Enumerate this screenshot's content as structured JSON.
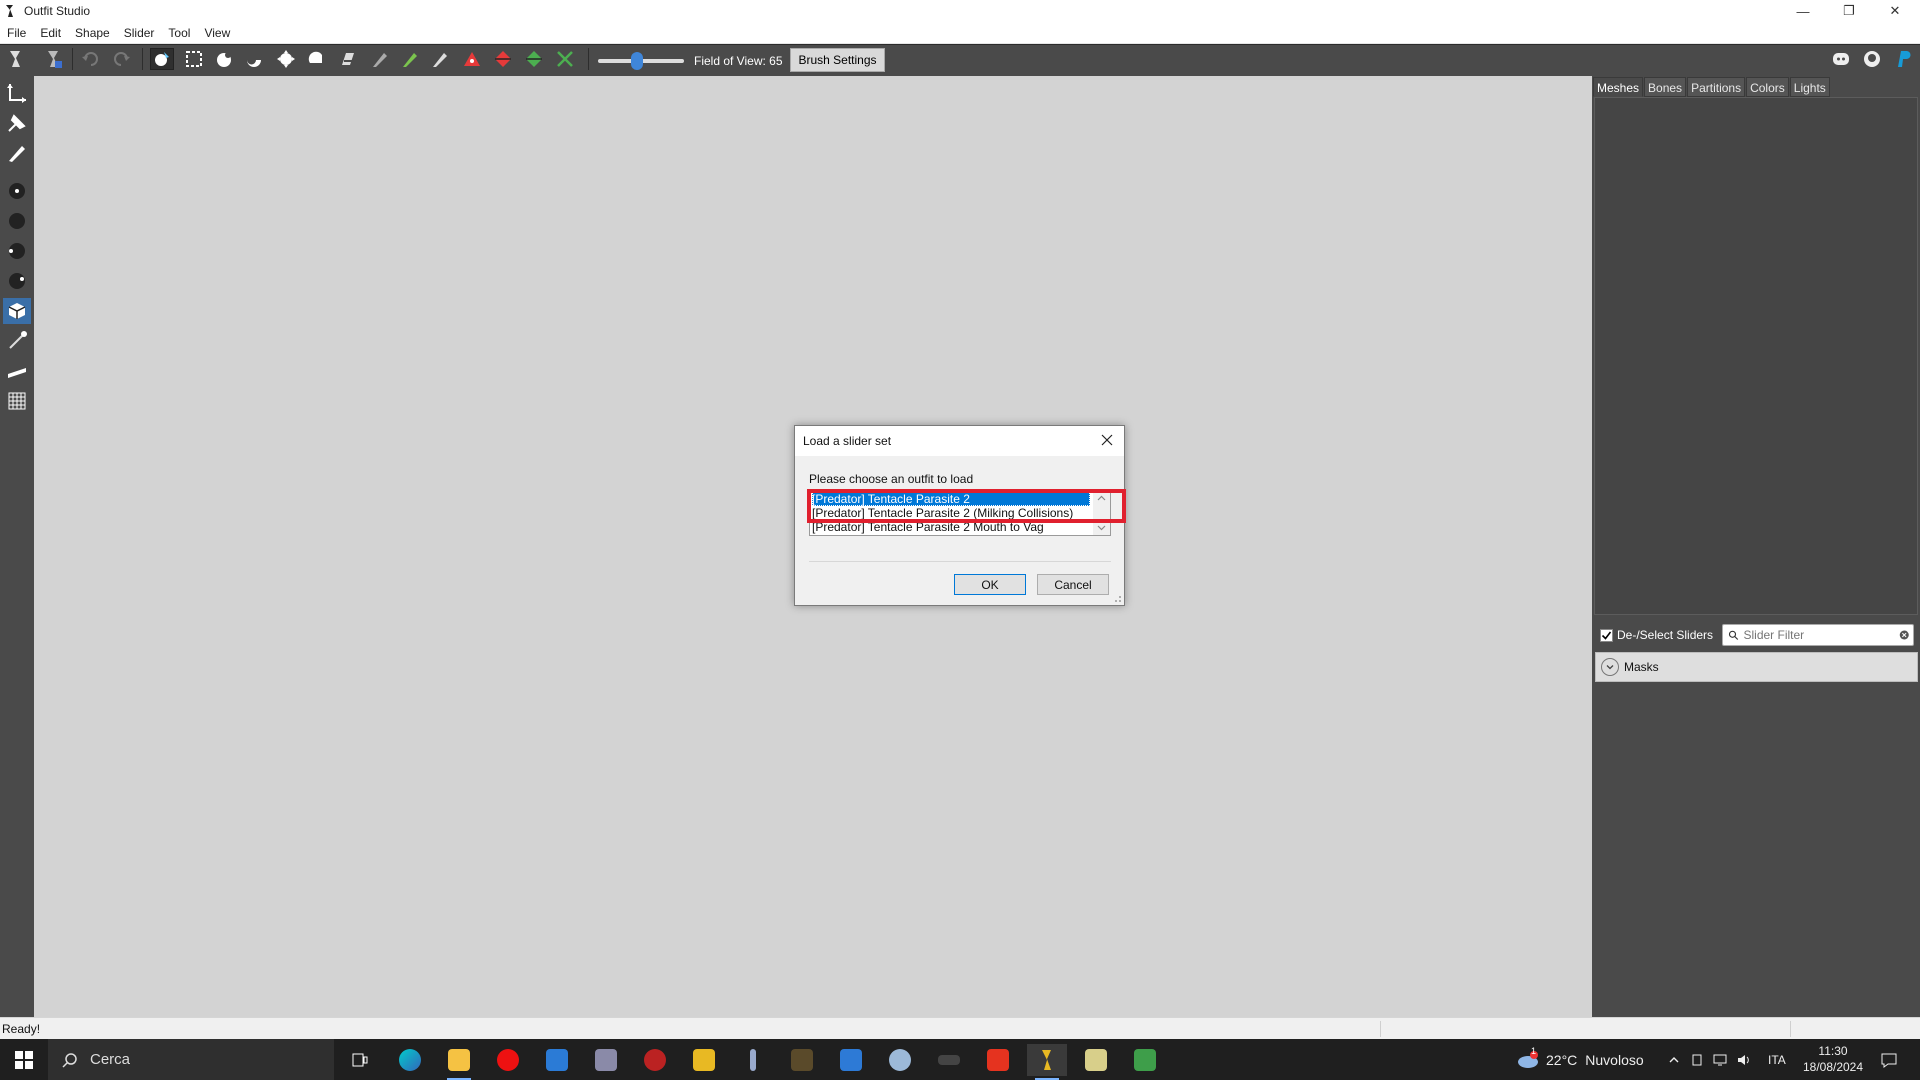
{
  "window": {
    "title": "Outfit Studio",
    "controls": {
      "minimize": "—",
      "restore": "❐",
      "close": "✕"
    }
  },
  "menu": [
    "File",
    "Edit",
    "Shape",
    "Slider",
    "Tool",
    "View"
  ],
  "toolbar": {
    "fov_label": "Field of View: 65",
    "fov_value": 65,
    "brush_settings": "Brush Settings",
    "icons": [
      "load-project-icon",
      "save-project-icon",
      "undo-icon",
      "redo-icon",
      "select-brush-icon",
      "mask-brush-icon",
      "inflate-brush-icon",
      "deflate-brush-icon",
      "move-brush-icon",
      "smooth-brush-icon",
      "undiff-brush-icon",
      "weight-brush-icon",
      "color-brush-icon",
      "alpha-brush-icon",
      "collapse-vertex-icon",
      "flip-edge-icon",
      "split-edge-icon",
      "delete-vertex-icon",
      "discord-icon",
      "github-icon",
      "paypal-icon"
    ]
  },
  "left_tools": [
    "transform-icon",
    "pivot-icon",
    "vertex-select-icon",
    "point-icon",
    "sphere-icon",
    "sphere-small-icon",
    "sphere-dot-icon",
    "cube-icon",
    "edge-icon",
    "bone-icon",
    "grid-icon"
  ],
  "right_panel": {
    "tabs": [
      "Meshes",
      "Bones",
      "Partitions",
      "Colors",
      "Lights"
    ],
    "active_tab": "Meshes",
    "deselect_label": "De-/Select Sliders",
    "deselect_checked": true,
    "filter_placeholder": "Slider Filter",
    "masks_label": "Masks"
  },
  "status": {
    "text": "Ready!"
  },
  "dialog": {
    "title": "Load a slider set",
    "prompt": "Please choose an outfit to load",
    "items": [
      "[Predator] Tentacle Parasite 2",
      "[Predator] Tentacle Parasite 2 (Milking Collisions)",
      "[Predator] Tentacle Parasite 2 Mouth to Vag"
    ],
    "selected_index": 0,
    "ok": "OK",
    "cancel": "Cancel"
  },
  "taskbar": {
    "search_placeholder": "Cerca",
    "weather_temp": "22°C",
    "weather_text": "Nuvoloso",
    "weather_badge": "1",
    "lang": "ITA",
    "time": "11:30",
    "date": "18/08/2024",
    "apps": [
      "task-view-icon",
      "edge-browser-icon",
      "file-explorer-icon",
      "opera-icon",
      "store-icon",
      "media-app-icon",
      "game-app-icon",
      "archive-app-icon",
      "pen-app-icon",
      "chess-app-icon",
      "window-app-icon",
      "tool-app-icon",
      "nvidia-icon",
      "foxit-icon",
      "outfit-studio-icon",
      "map-app-icon",
      "spreadsheet-icon"
    ]
  },
  "colors": {
    "accent": "#0078d7",
    "highlight": "#e0202e",
    "toolbar_bg": "#4a4a4a",
    "viewport_bg": "#d3d3d3"
  }
}
